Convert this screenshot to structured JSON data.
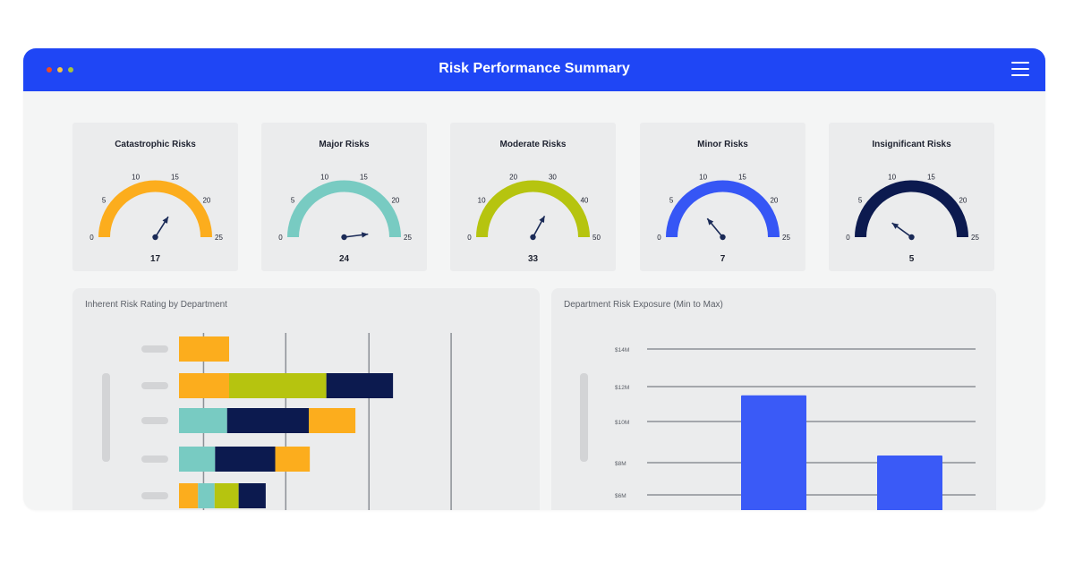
{
  "window": {
    "title": "Risk Performance Summary",
    "window_dot_colors": [
      "#ef4a23",
      "#f7c344",
      "#a8c43a"
    ],
    "menu_icon": "hamburger-icon"
  },
  "gauges": [
    {
      "label": "Catastrophic Risks",
      "value": 17,
      "min": 0,
      "max": 25,
      "ticks": [
        0,
        5,
        10,
        15,
        20,
        25
      ],
      "color": "#fcad1d"
    },
    {
      "label": "Major  Risks",
      "value": 24,
      "min": 0,
      "max": 25,
      "ticks": [
        0,
        5,
        10,
        15,
        20,
        25
      ],
      "color": "#78cbc2"
    },
    {
      "label": "Moderate Risks",
      "value": 33,
      "min": 0,
      "max": 50,
      "ticks": [
        0,
        10,
        20,
        30,
        40,
        50
      ],
      "color": "#b6c40f"
    },
    {
      "label": "Minor Risks",
      "value": 7,
      "min": 0,
      "max": 25,
      "ticks": [
        0,
        5,
        10,
        15,
        20,
        25
      ],
      "color": "#3656f5"
    },
    {
      "label": "Insignificant Risks",
      "value": 5,
      "min": 0,
      "max": 25,
      "ticks": [
        0,
        5,
        10,
        15,
        20,
        25
      ],
      "color": "#0c1a4f"
    }
  ],
  "colors": {
    "needle": "#1a2a57",
    "panel": "#ebeced",
    "grid": "#8c9096",
    "placeholder": "#d3d4d6",
    "bar_blue": "#3a5af7"
  },
  "inherent_panel": {
    "title": "Inherent Risk Rating by Department",
    "chart_data": {
      "type": "bar",
      "orientation": "horizontal",
      "stacked": true,
      "rows": [
        [
          {
            "value": 1.0,
            "color": "#fcad1d"
          }
        ],
        [
          {
            "value": 1.0,
            "color": "#fcad1d"
          },
          {
            "value": 1.94,
            "color": "#b6c40f"
          },
          {
            "value": 1.33,
            "color": "#0c1a4f"
          }
        ],
        [
          {
            "value": 0.96,
            "color": "#78cbc2"
          },
          {
            "value": 1.63,
            "color": "#0c1a4f"
          },
          {
            "value": 0.93,
            "color": "#fcad1d"
          }
        ],
        [
          {
            "value": 0.72,
            "color": "#78cbc2"
          },
          {
            "value": 1.2,
            "color": "#0c1a4f"
          },
          {
            "value": 0.69,
            "color": "#fcad1d"
          }
        ],
        [
          {
            "value": 0.38,
            "color": "#fcad1d"
          },
          {
            "value": 0.33,
            "color": "#78cbc2"
          },
          {
            "value": 0.48,
            "color": "#b6c40f"
          },
          {
            "value": 0.54,
            "color": "#0c1a4f"
          }
        ]
      ],
      "gridlines": [
        0.49,
        2.13,
        3.79,
        5.43
      ],
      "xlim": [
        0,
        6.3
      ]
    }
  },
  "exposure_panel": {
    "title": "Department Risk Exposure (Min to Max)",
    "chart_data": {
      "type": "bar",
      "y_ticks": [
        {
          "label": "$14M",
          "value": 14
        },
        {
          "label": "$12M",
          "value": 12
        },
        {
          "label": "$10M",
          "value": 10
        },
        {
          "label": "$8M",
          "value": 8
        },
        {
          "label": "$6M",
          "value": 6
        }
      ],
      "series": [
        {
          "values": [
            11.5,
            8.35
          ]
        }
      ]
    }
  }
}
